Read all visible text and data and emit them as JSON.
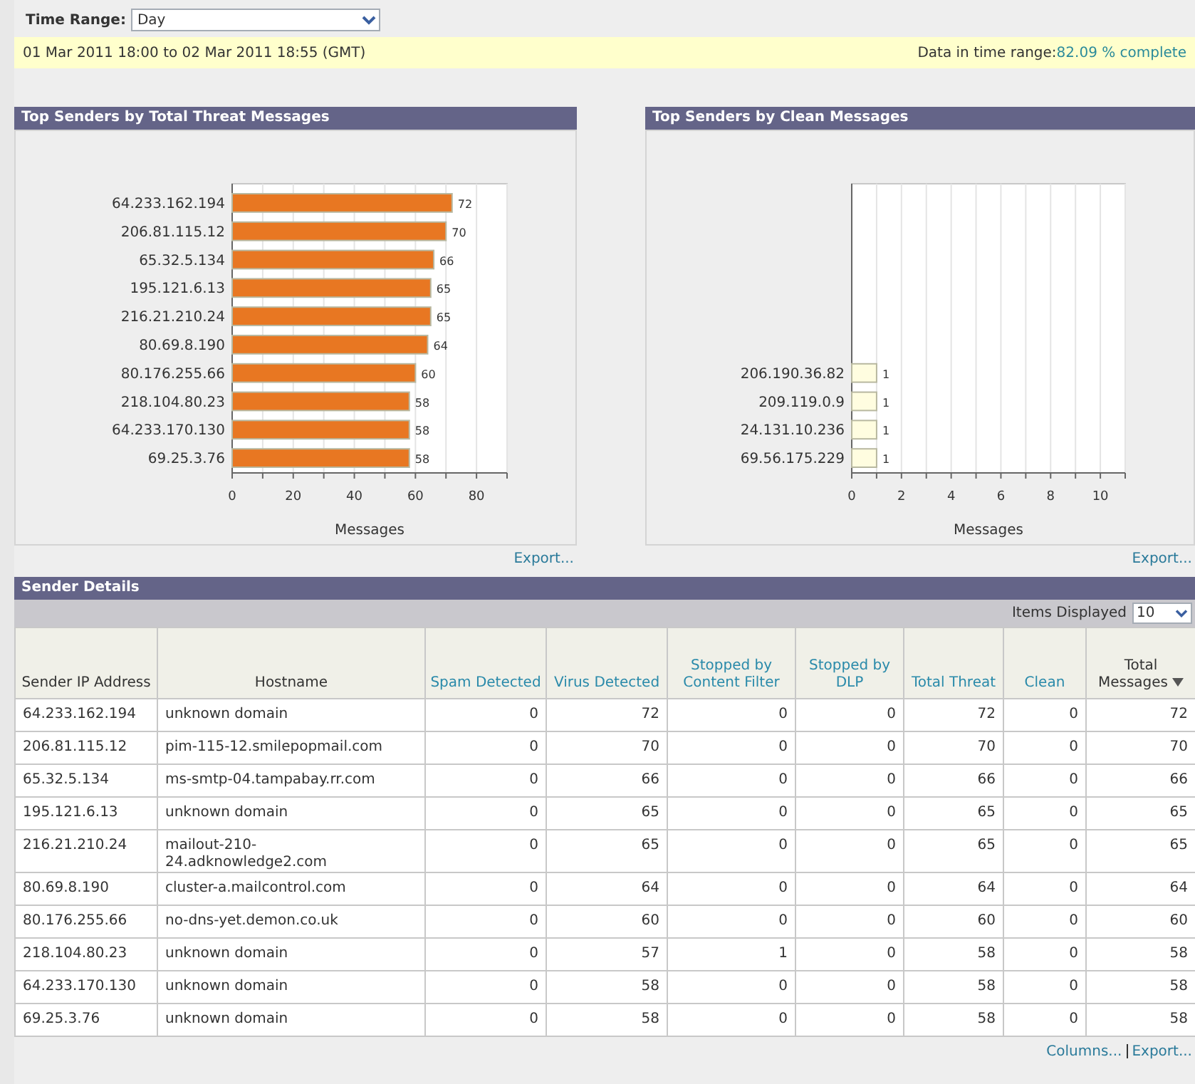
{
  "time_range": {
    "label": "Time Range:",
    "value": "Day"
  },
  "range_bar": {
    "dates": "01 Mar 2011 18:00 to 02 Mar 2011 18:55 (GMT)",
    "completeness_label": "Data in time range:",
    "completeness_value": "82.09 % complete"
  },
  "panels": [
    {
      "title": "Top Senders by Total Threat Messages",
      "export": "Export...",
      "chart_data": {
        "type": "bar",
        "orientation": "horizontal",
        "xlabel": "Messages",
        "categories": [
          "64.233.162.194",
          "206.81.115.12",
          "65.32.5.134",
          "195.121.6.13",
          "216.21.210.24",
          "80.69.8.190",
          "80.176.255.66",
          "218.104.80.23",
          "64.233.170.130",
          "69.25.3.76"
        ],
        "series": [
          {
            "color": "#e87722",
            "values": [
              72,
              70,
              66,
              65,
              65,
              64,
              60,
              58,
              58,
              58
            ]
          }
        ],
        "grid": true,
        "xlim": [
          0,
          90
        ],
        "xticks": [
          0,
          20,
          40,
          60,
          80
        ],
        "data_labels": true
      }
    },
    {
      "title": "Top Senders by Clean Messages",
      "export": "Export...",
      "chart_data": {
        "type": "bar",
        "orientation": "horizontal",
        "xlabel": "Messages",
        "categories": [
          "206.190.36.82",
          "209.119.0.9",
          "24.131.10.236",
          "69.56.175.229"
        ],
        "series": [
          {
            "color": "#fffde0",
            "values": [
              1,
              1,
              1,
              1
            ]
          }
        ],
        "grid": true,
        "xlim": [
          0,
          11
        ],
        "xticks": [
          0,
          2,
          4,
          6,
          8,
          10
        ],
        "data_labels": true
      }
    }
  ],
  "sender_details": {
    "title": "Sender Details",
    "items_displayed": {
      "label": "Items Displayed",
      "value": "10"
    },
    "columns": [
      {
        "label": "Sender IP Address",
        "link": false,
        "sorted": false
      },
      {
        "label": "Hostname",
        "link": false,
        "sorted": false
      },
      {
        "label": "Spam Detected",
        "link": true,
        "sorted": false
      },
      {
        "label": "Virus Detected",
        "link": true,
        "sorted": false
      },
      {
        "label": "Stopped by Content Filter",
        "link": true,
        "sorted": false
      },
      {
        "label": "Stopped by DLP",
        "link": true,
        "sorted": false
      },
      {
        "label": "Total Threat",
        "link": true,
        "sorted": false
      },
      {
        "label": "Clean",
        "link": true,
        "sorted": false
      },
      {
        "label": "Total Messages",
        "link": false,
        "sorted": true
      }
    ],
    "rows": [
      [
        "64.233.162.194",
        "unknown domain",
        "0",
        "72",
        "0",
        "0",
        "72",
        "0",
        "72"
      ],
      [
        "206.81.115.12",
        "pim-115-12.smilepopmail.com",
        "0",
        "70",
        "0",
        "0",
        "70",
        "0",
        "70"
      ],
      [
        "65.32.5.134",
        "ms-smtp-04.tampabay.rr.com",
        "0",
        "66",
        "0",
        "0",
        "66",
        "0",
        "66"
      ],
      [
        "195.121.6.13",
        "unknown domain",
        "0",
        "65",
        "0",
        "0",
        "65",
        "0",
        "65"
      ],
      [
        "216.21.210.24",
        "mailout-210-24.adknowledge2.com",
        "0",
        "65",
        "0",
        "0",
        "65",
        "0",
        "65"
      ],
      [
        "80.69.8.190",
        "cluster-a.mailcontrol.com",
        "0",
        "64",
        "0",
        "0",
        "64",
        "0",
        "64"
      ],
      [
        "80.176.255.66",
        "no-dns-yet.demon.co.uk",
        "0",
        "60",
        "0",
        "0",
        "60",
        "0",
        "60"
      ],
      [
        "218.104.80.23",
        "unknown domain",
        "0",
        "57",
        "1",
        "0",
        "58",
        "0",
        "58"
      ],
      [
        "64.233.170.130",
        "unknown domain",
        "0",
        "58",
        "0",
        "0",
        "58",
        "0",
        "58"
      ],
      [
        "69.25.3.76",
        "unknown domain",
        "0",
        "58",
        "0",
        "0",
        "58",
        "0",
        "58"
      ]
    ],
    "footer_links": [
      "Columns...",
      "Export..."
    ]
  }
}
